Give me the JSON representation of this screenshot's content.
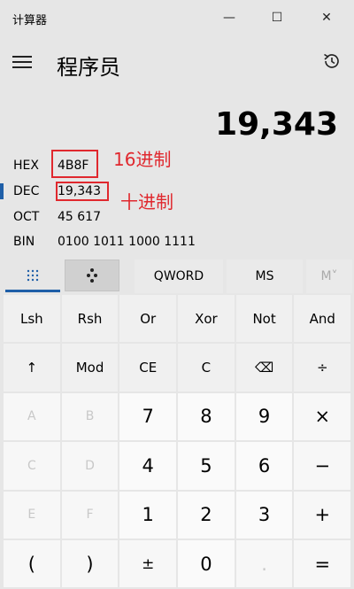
{
  "window": {
    "title": "计算器",
    "minimize": "—",
    "maximize": "☐",
    "close": "✕"
  },
  "header": {
    "mode": "程序员"
  },
  "display": {
    "value": "19,343"
  },
  "bases": [
    {
      "label": "HEX",
      "value": "4B8F"
    },
    {
      "label": "DEC",
      "value": "19,343"
    },
    {
      "label": "OCT",
      "value": "45 617"
    },
    {
      "label": "BIN",
      "value": "0100 1011 1000 1111"
    }
  ],
  "selected_base": "DEC",
  "annotations": {
    "hex_note": "16进制",
    "dec_note": "十进制",
    "color": "#e0282e"
  },
  "toolbar": {
    "word_size": "QWORD",
    "ms": "MS",
    "mplus": "M˅"
  },
  "keypad": [
    [
      "Lsh",
      "Rsh",
      "Or",
      "Xor",
      "Not",
      "And"
    ],
    [
      "↑",
      "Mod",
      "CE",
      "C",
      "⌫",
      "÷"
    ],
    [
      "A",
      "B",
      "7",
      "8",
      "9",
      "×"
    ],
    [
      "C",
      "D",
      "4",
      "5",
      "6",
      "−"
    ],
    [
      "E",
      "F",
      "1",
      "2",
      "3",
      "+"
    ],
    [
      "(",
      ")",
      "±",
      "0",
      ".",
      "="
    ]
  ],
  "accent_color": "#1f5fa8"
}
